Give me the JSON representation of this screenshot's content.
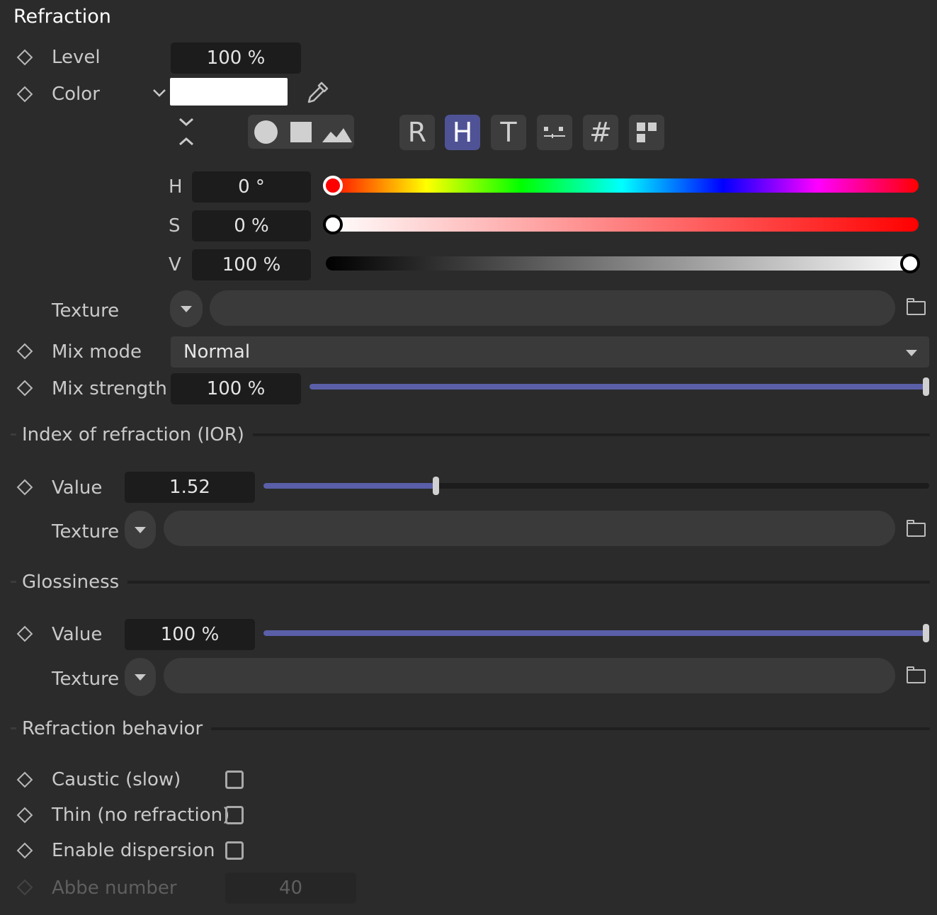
{
  "panel": {
    "title": "Refraction"
  },
  "level": {
    "label": "Level",
    "value": "100 %"
  },
  "color": {
    "label": "Color",
    "swatch": "#ffffff",
    "modes": [
      "R",
      "H",
      "T",
      "#"
    ],
    "active_mode": "H",
    "hsv": {
      "h_label": "H",
      "h_value": "0 °",
      "s_label": "S",
      "s_value": "0 %",
      "v_label": "V",
      "v_value": "100 %"
    }
  },
  "color_texture": {
    "label": "Texture",
    "value": ""
  },
  "mix_mode": {
    "label": "Mix mode",
    "value": "Normal"
  },
  "mix_strength": {
    "label": "Mix strength",
    "value": "100 %",
    "fraction": 1.0
  },
  "ior": {
    "section_title": "Index of refraction (IOR)",
    "value_label": "Value",
    "value": "1.52",
    "texture_label": "Texture"
  },
  "glossiness": {
    "section_title": "Glossiness",
    "value_label": "Value",
    "value": "100 %",
    "fraction": 1.0,
    "texture_label": "Texture"
  },
  "behavior": {
    "section_title": "Refraction behavior",
    "caustic_label": "Caustic (slow)",
    "thin_label": "Thin (no refraction)",
    "dispersion_label": "Enable dispersion",
    "abbe_label": "Abbe number",
    "abbe_value": "40"
  },
  "colors": {
    "accent": "#5a5fa8",
    "active_mode": "#4f5396",
    "background": "#2b2b2b"
  }
}
